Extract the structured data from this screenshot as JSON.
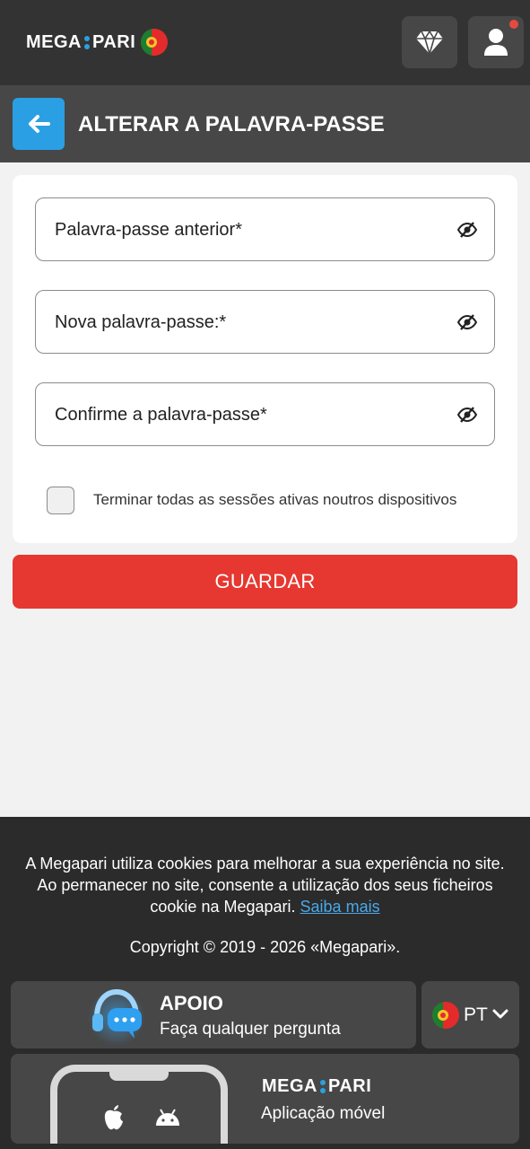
{
  "header": {
    "logo_left": "MEGA",
    "logo_right": "PARI",
    "logo_flag": "portugal-flag-icon",
    "diamond_icon": "diamond-icon",
    "user_icon": "user-icon"
  },
  "page": {
    "title": "ALTERAR A PALAVRA-PASSE",
    "back_icon": "arrow-left-icon"
  },
  "form": {
    "old_password_placeholder": "Palavra-passe anterior*",
    "new_password_placeholder": "Nova palavra-passe:*",
    "confirm_password_placeholder": "Confirme a palavra-passe*",
    "eye_icon": "eye-hidden-icon",
    "terminate_sessions_label": "Terminar todas as sessões ativas noutros dispositivos",
    "terminate_sessions_checked": false,
    "save_label": "GUARDAR"
  },
  "footer": {
    "cookie_text": "A Megapari utiliza cookies para melhorar a sua experiência no site. Ao permanecer no site, consente a utilização dos seus ficheiros cookie na Megapari.",
    "cookie_link": "Saiba mais",
    "copyright": "Copyright © 2019 - 2026 «Megapari».",
    "support_title": "APOIO",
    "support_subtitle": "Faça qualquer pergunta",
    "language": "PT",
    "app_logo_left": "MEGA",
    "app_logo_right": "PARI",
    "app_subtitle": "Aplicação móvel"
  },
  "colors": {
    "topbar": "#333333",
    "headbar": "#474747",
    "accent_blue": "#2b9fe3",
    "save_red": "#e63830",
    "footer": "#2b2b2b"
  }
}
